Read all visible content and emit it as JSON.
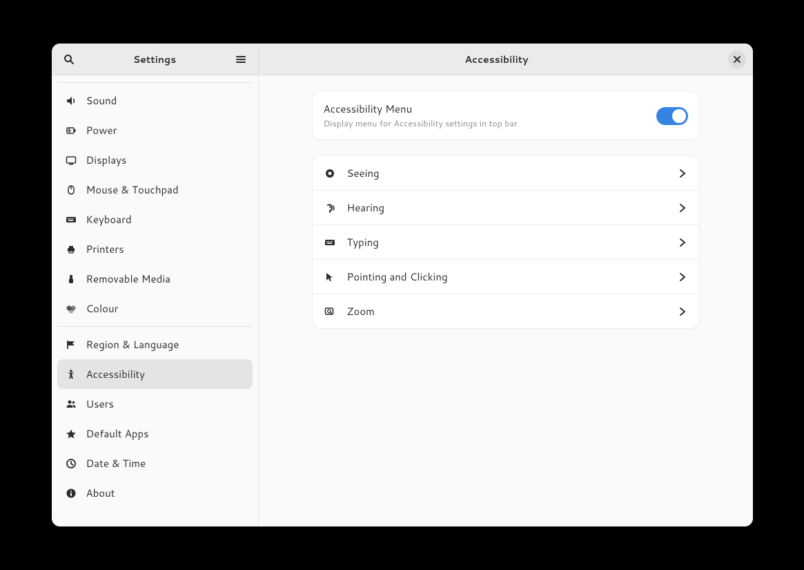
{
  "titlebar": {
    "sidebar_title": "Settings",
    "main_title": "Accessibility"
  },
  "sidebar": {
    "groups": [
      [
        {
          "id": "sound",
          "icon": "speaker-icon",
          "label": "Sound"
        },
        {
          "id": "power",
          "icon": "battery-icon",
          "label": "Power"
        },
        {
          "id": "displays",
          "icon": "display-icon",
          "label": "Displays"
        },
        {
          "id": "mouse",
          "icon": "mouse-icon",
          "label": "Mouse & Touchpad"
        },
        {
          "id": "keyboard",
          "icon": "keyboard-icon",
          "label": "Keyboard"
        },
        {
          "id": "printers",
          "icon": "printer-icon",
          "label": "Printers"
        },
        {
          "id": "removable",
          "icon": "usb-icon",
          "label": "Removable Media"
        },
        {
          "id": "colour",
          "icon": "colour-icon",
          "label": "Colour"
        }
      ],
      [
        {
          "id": "region",
          "icon": "flag-icon",
          "label": "Region & Language"
        },
        {
          "id": "accessibility",
          "icon": "accessibility-icon",
          "label": "Accessibility",
          "selected": true
        },
        {
          "id": "users",
          "icon": "users-icon",
          "label": "Users"
        },
        {
          "id": "defaultapps",
          "icon": "star-icon",
          "label": "Default Apps"
        },
        {
          "id": "datetime",
          "icon": "clock-icon",
          "label": "Date & Time"
        },
        {
          "id": "about",
          "icon": "info-icon",
          "label": "About"
        }
      ]
    ]
  },
  "main": {
    "menu_card": {
      "title": "Accessibility Menu",
      "subtitle": "Display menu for Accessibility settings in top bar",
      "switch_on": true
    },
    "list": [
      {
        "id": "seeing",
        "icon": "eye-icon",
        "label": "Seeing"
      },
      {
        "id": "hearing",
        "icon": "ear-icon",
        "label": "Hearing"
      },
      {
        "id": "typing",
        "icon": "keyboard-icon",
        "label": "Typing"
      },
      {
        "id": "pointing",
        "icon": "cursor-icon",
        "label": "Pointing and Clicking"
      },
      {
        "id": "zoom",
        "icon": "zoom-icon",
        "label": "Zoom"
      }
    ]
  },
  "colors": {
    "accent": "#3584e4"
  }
}
